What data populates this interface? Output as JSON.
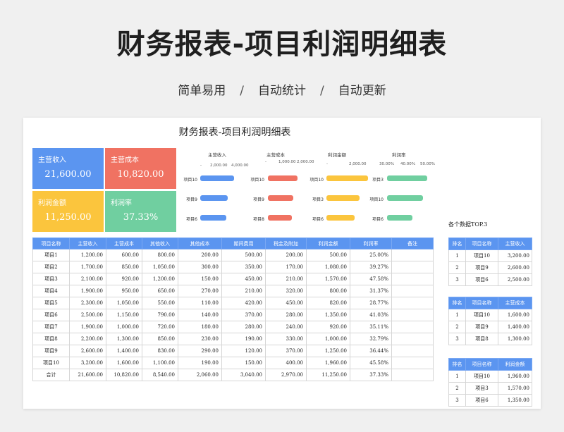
{
  "hero": {
    "title": "财务报表-项目利润明细表",
    "tags": [
      "简单易用",
      "自动统计",
      "自动更新"
    ],
    "separator": "/"
  },
  "sheet": {
    "title": "财务报表-项目利润明细表",
    "kpis": [
      {
        "label": "主营收入",
        "value": "21,600.00",
        "color": "#5b95f0"
      },
      {
        "label": "主营成本",
        "value": "10,820.00",
        "color": "#f07262"
      },
      {
        "label": "利润金额",
        "value": "11,250.00",
        "color": "#fbc53d"
      },
      {
        "label": "利润率",
        "value": "37.33%",
        "color": "#70cfa0"
      }
    ],
    "mini_charts": [
      {
        "title": "主营收入",
        "axis": [
          "-",
          "2,000.00",
          "4,000.00"
        ],
        "color": "#5b95f0",
        "items": [
          {
            "label": "项目10",
            "value": 3200
          },
          {
            "label": "项目9",
            "value": 2600
          },
          {
            "label": "项目6",
            "value": 2500
          }
        ],
        "max": 4000
      },
      {
        "title": "主营成本",
        "axis": [
          "-",
          "1,000.00",
          "2,000.00"
        ],
        "color": "#f07262",
        "items": [
          {
            "label": "项目10",
            "value": 1600
          },
          {
            "label": "项目9",
            "value": 1400
          },
          {
            "label": "项目8",
            "value": 1300
          }
        ],
        "max": 2000
      },
      {
        "title": "利润金额",
        "axis": [
          "-",
          "2,000.00"
        ],
        "color": "#fbc53d",
        "items": [
          {
            "label": "项目10",
            "value": 1960
          },
          {
            "label": "项目3",
            "value": 1570
          },
          {
            "label": "项目6",
            "value": 1350
          }
        ],
        "max": 2000
      },
      {
        "title": "利润率",
        "axis": [
          "30.00%",
          "40.00%",
          "50.00%"
        ],
        "color": "#70cfa0",
        "items": [
          {
            "label": "项目3",
            "value": 47.58
          },
          {
            "label": "项目10",
            "value": 45.58
          },
          {
            "label": "项目6",
            "value": 41.03
          }
        ],
        "min": 30,
        "max": 50
      }
    ],
    "table": {
      "headers": [
        "项目名称",
        "主营收入",
        "主营成本",
        "其他收入",
        "其他成本",
        "期间费用",
        "税金及附加",
        "利润金额",
        "利润率",
        "备注"
      ],
      "rows": [
        [
          "项目1",
          "1,200.00",
          "600.00",
          "800.00",
          "200.00",
          "500.00",
          "200.00",
          "500.00",
          "25.00%",
          ""
        ],
        [
          "项目2",
          "1,700.00",
          "850.00",
          "1,050.00",
          "300.00",
          "350.00",
          "170.00",
          "1,080.00",
          "39.27%",
          ""
        ],
        [
          "项目3",
          "2,100.00",
          "920.00",
          "1,200.00",
          "150.00",
          "450.00",
          "210.00",
          "1,570.00",
          "47.58%",
          ""
        ],
        [
          "项目4",
          "1,900.00",
          "950.00",
          "650.00",
          "270.00",
          "210.00",
          "320.00",
          "800.00",
          "31.37%",
          ""
        ],
        [
          "项目5",
          "2,300.00",
          "1,050.00",
          "550.00",
          "110.00",
          "420.00",
          "450.00",
          "820.00",
          "28.77%",
          ""
        ],
        [
          "项目6",
          "2,500.00",
          "1,150.00",
          "790.00",
          "140.00",
          "370.00",
          "280.00",
          "1,350.00",
          "41.03%",
          ""
        ],
        [
          "项目7",
          "1,900.00",
          "1,000.00",
          "720.00",
          "180.00",
          "280.00",
          "240.00",
          "920.00",
          "35.11%",
          ""
        ],
        [
          "项目8",
          "2,200.00",
          "1,300.00",
          "850.00",
          "230.00",
          "190.00",
          "330.00",
          "1,000.00",
          "32.79%",
          ""
        ],
        [
          "项目9",
          "2,600.00",
          "1,400.00",
          "830.00",
          "290.00",
          "120.00",
          "370.00",
          "1,250.00",
          "36.44%",
          ""
        ],
        [
          "项目10",
          "3,200.00",
          "1,600.00",
          "1,100.00",
          "190.00",
          "150.00",
          "400.00",
          "1,960.00",
          "45.58%",
          ""
        ],
        [
          "合计",
          "21,600.00",
          "10,820.00",
          "8,540.00",
          "2,060.00",
          "3,040.00",
          "2,970.00",
          "11,250.00",
          "37.33%",
          ""
        ]
      ]
    },
    "top3": {
      "title": "各个数据TOP.3",
      "tables": [
        {
          "headers": [
            "排名",
            "项目名称",
            "主营收入"
          ],
          "rows": [
            [
              "1",
              "项目10",
              "3,200.00"
            ],
            [
              "2",
              "项目9",
              "2,600.00"
            ],
            [
              "3",
              "项目6",
              "2,500.00"
            ]
          ]
        },
        {
          "headers": [
            "排名",
            "项目名称",
            "主营成本"
          ],
          "rows": [
            [
              "1",
              "项目10",
              "1,600.00"
            ],
            [
              "2",
              "项目9",
              "1,400.00"
            ],
            [
              "3",
              "项目8",
              "1,300.00"
            ]
          ]
        },
        {
          "headers": [
            "排名",
            "项目名称",
            "利润金额"
          ],
          "rows": [
            [
              "1",
              "项目10",
              "1,960.00"
            ],
            [
              "2",
              "项目3",
              "1,570.00"
            ],
            [
              "3",
              "项目6",
              "1,350.00"
            ]
          ]
        }
      ]
    }
  }
}
